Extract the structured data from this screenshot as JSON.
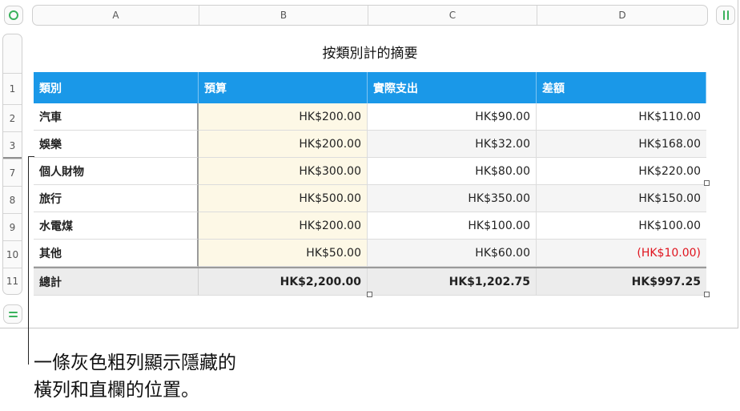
{
  "columns": [
    "A",
    "B",
    "C",
    "D"
  ],
  "rows": [
    "1",
    "2",
    "3",
    "7",
    "8",
    "9",
    "10",
    "11"
  ],
  "table": {
    "title": "按類別計的摘要",
    "headers": [
      "類別",
      "預算",
      "實際支出",
      "差額"
    ],
    "body": [
      [
        "汽車",
        "HK$200.00",
        "HK$90.00",
        "HK$110.00"
      ],
      [
        "娛樂",
        "HK$200.00",
        "HK$32.00",
        "HK$168.00"
      ],
      [
        "個人財物",
        "HK$300.00",
        "HK$80.00",
        "HK$220.00"
      ],
      [
        "旅行",
        "HK$500.00",
        "HK$350.00",
        "HK$150.00"
      ],
      [
        "水電煤",
        "HK$200.00",
        "HK$100.00",
        "HK$100.00"
      ],
      [
        "其他",
        "HK$50.00",
        "HK$60.00",
        "(HK$10.00)"
      ]
    ],
    "total": [
      "總計",
      "HK$2,200.00",
      "HK$1,202.75",
      "HK$997.25"
    ]
  },
  "callout": {
    "line1": "一條灰色粗列顯示隱藏的",
    "line2": "橫列和直欄的位置。"
  },
  "colors": {
    "header": "#1a98e8",
    "negative": "#e0141e",
    "accent": "#3ab25c"
  }
}
